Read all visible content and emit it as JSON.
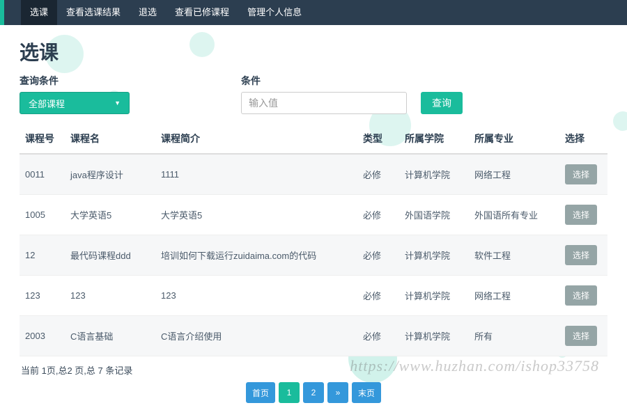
{
  "nav": {
    "items": [
      {
        "label": "选课",
        "active": true
      },
      {
        "label": "查看选课结果",
        "active": false
      },
      {
        "label": "退选",
        "active": false
      },
      {
        "label": "查看已修课程",
        "active": false
      },
      {
        "label": "管理个人信息",
        "active": false
      }
    ]
  },
  "page": {
    "title": "选课"
  },
  "filter": {
    "queryLabel": "查询条件",
    "dropdownValue": "全部课程",
    "conditionLabel": "条件",
    "inputPlaceholder": "输入值",
    "submitLabel": "查询"
  },
  "table": {
    "headers": {
      "id": "课程号",
      "name": "课程名",
      "desc": "课程简介",
      "type": "类型",
      "college": "所属学院",
      "major": "所属专业",
      "action": "选择"
    },
    "actionLabel": "选择",
    "rows": [
      {
        "id": "0011",
        "name": "java程序设计",
        "desc": "1111",
        "type": "必修",
        "college": "计算机学院",
        "major": "网络工程"
      },
      {
        "id": "1005",
        "name": "大学英语5",
        "desc": "大学英语5",
        "type": "必修",
        "college": "外国语学院",
        "major": "外国语所有专业"
      },
      {
        "id": "12",
        "name": "最代码课程ddd",
        "desc": "培训如何下载运行zuidaima.com的代码",
        "type": "必修",
        "college": "计算机学院",
        "major": "软件工程"
      },
      {
        "id": "123",
        "name": "123",
        "desc": "123",
        "type": "必修",
        "college": "计算机学院",
        "major": "网络工程"
      },
      {
        "id": "2003",
        "name": "C语言基础",
        "desc": "C语言介绍使用",
        "type": "必修",
        "college": "计算机学院",
        "major": "所有"
      }
    ]
  },
  "pagination": {
    "summary": "当前 1页,总2 页,总 7 条记录",
    "first": "首页",
    "p1": "1",
    "p2": "2",
    "next": "»",
    "last": "末页"
  },
  "watermark": "https://www.huzhan.com/ishop33758"
}
